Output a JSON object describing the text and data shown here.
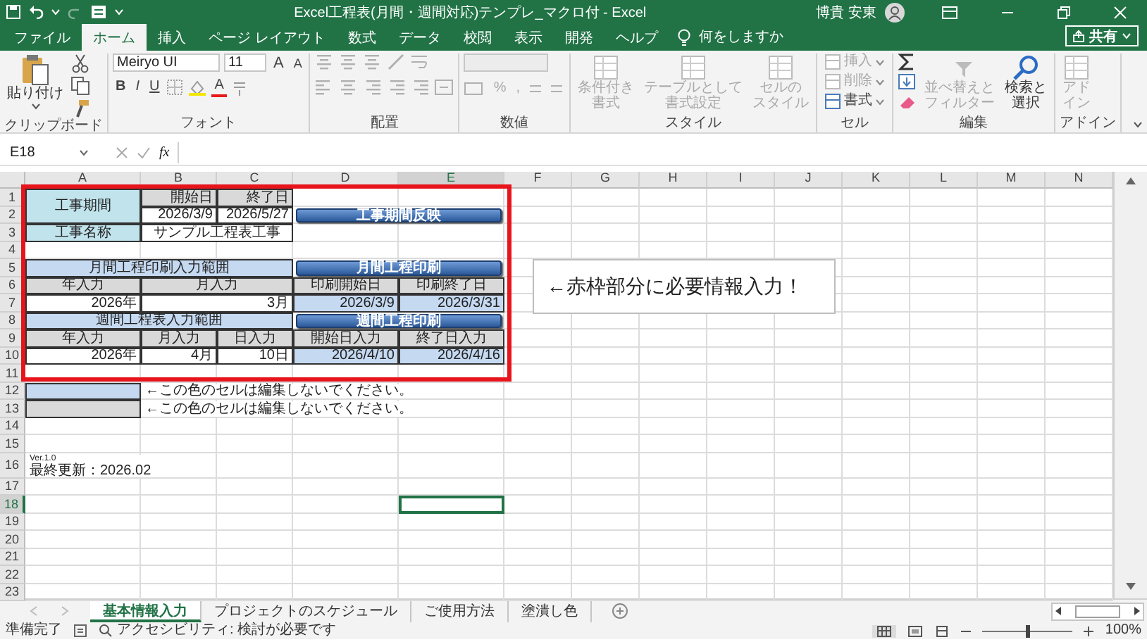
{
  "window": {
    "title": "Excel工程表(月間・週間対応)テンプレ_マクロ付 - Excel",
    "user": "博貴 安東"
  },
  "ribbon_tabs": [
    {
      "label": "ファイル",
      "selected": false
    },
    {
      "label": "ホーム",
      "selected": true
    },
    {
      "label": "挿入",
      "selected": false
    },
    {
      "label": "ページ レイアウト",
      "selected": false
    },
    {
      "label": "数式",
      "selected": false
    },
    {
      "label": "データ",
      "selected": false
    },
    {
      "label": "校閲",
      "selected": false
    },
    {
      "label": "表示",
      "selected": false
    },
    {
      "label": "開発",
      "selected": false
    },
    {
      "label": "ヘルプ",
      "selected": false
    }
  ],
  "tell_me": {
    "placeholder": "何をしますか"
  },
  "share_button": "共有",
  "ribbon_groups": [
    {
      "kind": "clipboard",
      "label": "クリップボード",
      "paste": "貼り付け"
    },
    {
      "kind": "font",
      "label": "フォント",
      "font_name": "Meiryo UI",
      "font_size": "11",
      "size_buttons": [
        "A",
        "A"
      ],
      "styles": [
        "B",
        "I",
        "U"
      ],
      "color_letter": "A"
    },
    {
      "kind": "alignment",
      "label": "配置"
    },
    {
      "kind": "number",
      "label": "数値",
      "symbols": [
        "%",
        ","
      ]
    },
    {
      "kind": "big_buttons",
      "label": "スタイル",
      "items": [
        {
          "lines": [
            "条件付き",
            "書式"
          ],
          "disabled": true
        },
        {
          "lines": [
            "テーブルとして",
            "書式設定"
          ],
          "disabled": true
        },
        {
          "lines": [
            "セルの",
            "スタイル"
          ],
          "disabled": true
        }
      ]
    },
    {
      "kind": "cells",
      "label": "セル",
      "items": [
        {
          "label": "挿入",
          "disabled": true
        },
        {
          "label": "削除",
          "disabled": true
        },
        {
          "label": "書式",
          "disabled": false
        }
      ]
    },
    {
      "kind": "editing",
      "label": "編集",
      "items": [
        {
          "lines": [
            "並べ替えと",
            "フィルター"
          ],
          "disabled": true
        },
        {
          "lines": [
            "検索と",
            "選択"
          ],
          "disabled": false
        }
      ]
    },
    {
      "kind": "big_buttons",
      "label": "アドイン",
      "items": [
        {
          "lines": [
            "アド",
            "イン"
          ],
          "disabled": true
        }
      ]
    }
  ],
  "formula_bar": {
    "name_box": "E18",
    "function_label": "fx"
  },
  "columns": [
    {
      "label": "A",
      "selected": false
    },
    {
      "label": "B",
      "selected": false
    },
    {
      "label": "C",
      "selected": false
    },
    {
      "label": "D",
      "selected": false
    },
    {
      "label": "E",
      "selected": true
    },
    {
      "label": "F",
      "selected": false
    },
    {
      "label": "G",
      "selected": false
    },
    {
      "label": "H",
      "selected": false
    },
    {
      "label": "I",
      "selected": false
    },
    {
      "label": "J",
      "selected": false
    },
    {
      "label": "K",
      "selected": false
    },
    {
      "label": "L",
      "selected": false
    },
    {
      "label": "M",
      "selected": false
    },
    {
      "label": "N",
      "selected": false
    }
  ],
  "rows": [
    {
      "label": "1",
      "selected": false
    },
    {
      "label": "2",
      "selected": false
    },
    {
      "label": "3",
      "selected": false
    },
    {
      "label": "4",
      "selected": false
    },
    {
      "label": "5",
      "selected": false
    },
    {
      "label": "6",
      "selected": false
    },
    {
      "label": "7",
      "selected": false
    },
    {
      "label": "8",
      "selected": false
    },
    {
      "label": "9",
      "selected": false
    },
    {
      "label": "10",
      "selected": false
    },
    {
      "label": "11",
      "selected": false
    },
    {
      "label": "12",
      "selected": false
    },
    {
      "label": "13",
      "selected": false
    },
    {
      "label": "14",
      "selected": false
    },
    {
      "label": "15",
      "selected": false
    },
    {
      "label": "16",
      "selected": false
    },
    {
      "label": "17",
      "selected": false
    },
    {
      "label": "18",
      "selected": true
    },
    {
      "label": "19",
      "selected": false
    },
    {
      "label": "20",
      "selected": false
    },
    {
      "label": "21",
      "selected": false
    },
    {
      "label": "22",
      "selected": false
    },
    {
      "label": "23",
      "selected": false
    }
  ],
  "cells": [
    {
      "text": "工事期間",
      "kind": "label"
    },
    {
      "text": "開始日",
      "kind": "header"
    },
    {
      "text": "終了日",
      "kind": "header"
    },
    {
      "text": "2026/3/9",
      "kind": "input"
    },
    {
      "text": "2026/5/27",
      "kind": "input"
    },
    {
      "text": "工事名称",
      "kind": "label"
    },
    {
      "text": "サンプル工程表工事",
      "kind": "input"
    },
    {
      "text": "月間工程印刷入力範囲",
      "kind": "band"
    },
    {
      "text": "年入力",
      "kind": "header"
    },
    {
      "text": "月入力",
      "kind": "header"
    },
    {
      "text": "印刷開始日",
      "kind": "header"
    },
    {
      "text": "印刷終了日",
      "kind": "header"
    },
    {
      "text": "2026年",
      "kind": "input"
    },
    {
      "text": "3月",
      "kind": "input"
    },
    {
      "text": "2026/3/9",
      "kind": "computed"
    },
    {
      "text": "2026/3/31",
      "kind": "computed"
    },
    {
      "text": "週間工程表入力範囲",
      "kind": "band"
    },
    {
      "text": "年入力",
      "kind": "header"
    },
    {
      "text": "月入力",
      "kind": "header"
    },
    {
      "text": "日入力",
      "kind": "header"
    },
    {
      "text": "開始日入力",
      "kind": "header"
    },
    {
      "text": "終了日入力",
      "kind": "header"
    },
    {
      "text": "2026年",
      "kind": "input"
    },
    {
      "text": "4月",
      "kind": "input"
    },
    {
      "text": "10日",
      "kind": "input"
    },
    {
      "text": "2026/4/10",
      "kind": "computed"
    },
    {
      "text": "2026/4/16",
      "kind": "computed"
    },
    {
      "kind": "computed"
    },
    {
      "text": "←この色のセルは編集しないでください。",
      "kind": "note"
    },
    {
      "kind": "header"
    },
    {
      "text": "←この色のセルは編集しないでください。",
      "kind": "note"
    },
    {
      "lines": [
        "Ver.1.0",
        "最終更新：2026.02"
      ],
      "kind": "version"
    }
  ],
  "macro_buttons": [
    {
      "label": "工事期間反映"
    },
    {
      "label": "月間工程印刷"
    },
    {
      "label": "週間工程印刷"
    }
  ],
  "callout": {
    "text": "←赤枠部分に必要情報入力！"
  },
  "sheet_tabs": [
    {
      "label": "基本情報入力",
      "selected": true
    },
    {
      "label": "プロジェクトのスケジュール",
      "selected": false
    },
    {
      "label": "ご使用方法",
      "selected": false
    },
    {
      "label": "塗潰し色",
      "selected": false
    }
  ],
  "status_bar": {
    "ready": "準備完了",
    "accessibility": "アクセシビリティ: 検討が必要です",
    "zoom": "100%",
    "zoom_slider": {
      "level": 0.5
    }
  }
}
